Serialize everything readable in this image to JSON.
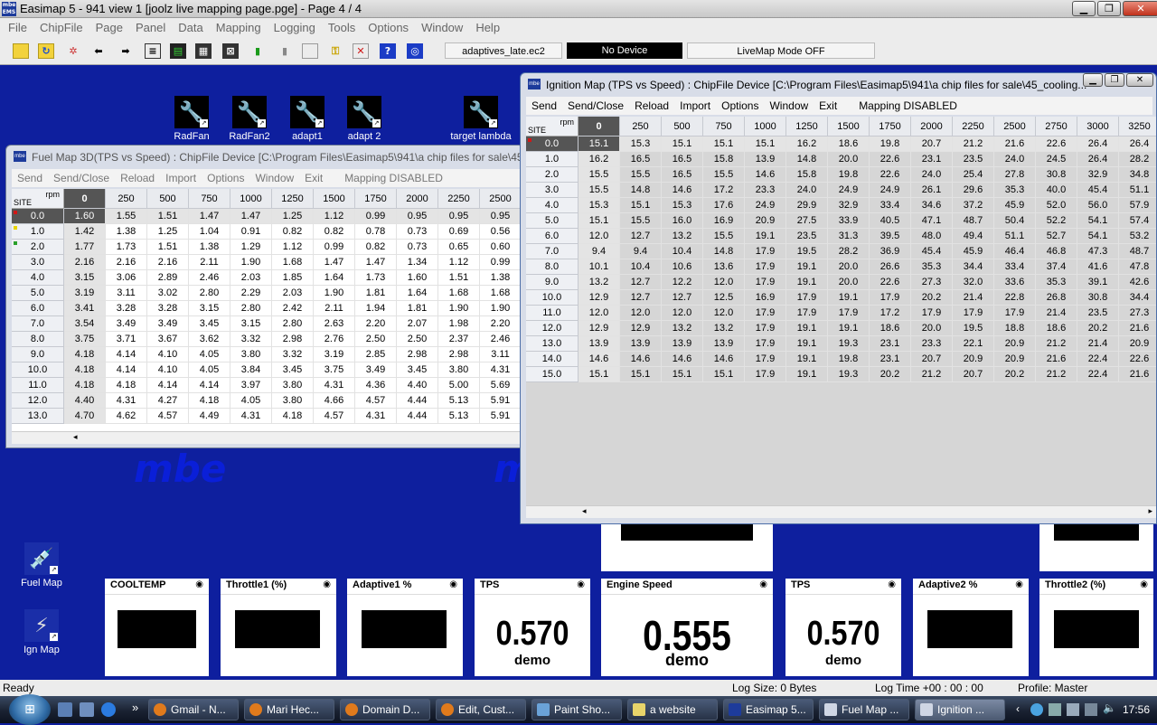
{
  "app": {
    "title": "Easimap 5 - 941 view 1 [joolz live mapping page.pge] - Page 4 / 4",
    "logo": "mbe EMS",
    "minimize": "▁",
    "restore": "❐",
    "close": "✕"
  },
  "menu": [
    "File",
    "ChipFile",
    "Page",
    "Panel",
    "Data",
    "Mapping",
    "Logging",
    "Tools",
    "Options",
    "Window",
    "Help"
  ],
  "toolbar": {
    "icons": [
      "open-icon",
      "folder-icon",
      "settings-icon",
      "back-arrow-icon",
      "forward-arrow-icon",
      "page-icon",
      "chip-icon",
      "grid-icon",
      "map-icon",
      "traffic-light-icon",
      "disk-icon",
      "blank-icon",
      "key-icon",
      "delete-icon",
      "help-icon",
      "target-icon"
    ],
    "file_field": "adaptives_late.ec2",
    "device_field": "No Device",
    "livemap_field": "LiveMap Mode OFF"
  },
  "desktop_icons": [
    {
      "label": "RadFan",
      "icon": "wrench-icon"
    },
    {
      "label": "RadFan2",
      "icon": "wrench-icon"
    },
    {
      "label": "adapt1",
      "icon": "wrench-icon"
    },
    {
      "label": "adapt 2",
      "icon": "wrench-icon"
    },
    {
      "label": "target lambda",
      "icon": "wrench-icon"
    },
    {
      "label": "Fuel Map",
      "icon": "injector-icon"
    },
    {
      "label": "Ign Map",
      "icon": "spark-plug-icon"
    }
  ],
  "watermark": "mbe",
  "fuel_map": {
    "title": "Fuel Map 3D(TPS vs Speed) : ChipFile Device [C:\\Program Files\\Easimap5\\941\\a chip files for sale\\45",
    "menu": [
      "Send",
      "Send/Close",
      "Reload",
      "Import",
      "Options",
      "Window",
      "Exit",
      "Mapping DISABLED"
    ],
    "corner_rpm": "rpm",
    "corner_site": "SITE",
    "columns": [
      "0",
      "250",
      "500",
      "750",
      "1000",
      "1250",
      "1500",
      "1750",
      "2000",
      "2250",
      "2500"
    ],
    "rows": [
      "0.0",
      "1.0",
      "2.0",
      "3.0",
      "4.0",
      "5.0",
      "6.0",
      "7.0",
      "8.0",
      "9.0",
      "10.0",
      "11.0",
      "12.0",
      "13.0"
    ],
    "cells": [
      [
        "1.60",
        "1.55",
        "1.51",
        "1.47",
        "1.47",
        "1.25",
        "1.12",
        "0.99",
        "0.95",
        "0.95",
        "0.95"
      ],
      [
        "1.42",
        "1.38",
        "1.25",
        "1.04",
        "0.91",
        "0.82",
        "0.82",
        "0.78",
        "0.73",
        "0.69",
        "0.56"
      ],
      [
        "1.77",
        "1.73",
        "1.51",
        "1.38",
        "1.29",
        "1.12",
        "0.99",
        "0.82",
        "0.73",
        "0.65",
        "0.60"
      ],
      [
        "2.16",
        "2.16",
        "2.16",
        "2.11",
        "1.90",
        "1.68",
        "1.47",
        "1.47",
        "1.34",
        "1.12",
        "0.99"
      ],
      [
        "3.15",
        "3.06",
        "2.89",
        "2.46",
        "2.03",
        "1.85",
        "1.64",
        "1.73",
        "1.60",
        "1.51",
        "1.38"
      ],
      [
        "3.19",
        "3.11",
        "3.02",
        "2.80",
        "2.29",
        "2.03",
        "1.90",
        "1.81",
        "1.64",
        "1.68",
        "1.68"
      ],
      [
        "3.41",
        "3.28",
        "3.28",
        "3.15",
        "2.80",
        "2.42",
        "2.11",
        "1.94",
        "1.81",
        "1.90",
        "1.90"
      ],
      [
        "3.54",
        "3.49",
        "3.49",
        "3.45",
        "3.15",
        "2.80",
        "2.63",
        "2.20",
        "2.07",
        "1.98",
        "2.20"
      ],
      [
        "3.75",
        "3.71",
        "3.67",
        "3.62",
        "3.32",
        "2.98",
        "2.76",
        "2.50",
        "2.50",
        "2.37",
        "2.46"
      ],
      [
        "4.18",
        "4.14",
        "4.10",
        "4.05",
        "3.80",
        "3.32",
        "3.19",
        "2.85",
        "2.98",
        "2.98",
        "3.11"
      ],
      [
        "4.18",
        "4.14",
        "4.10",
        "4.05",
        "3.84",
        "3.45",
        "3.75",
        "3.49",
        "3.45",
        "3.80",
        "4.31"
      ],
      [
        "4.18",
        "4.18",
        "4.14",
        "4.14",
        "3.97",
        "3.80",
        "4.31",
        "4.36",
        "4.40",
        "5.00",
        "5.69"
      ],
      [
        "4.40",
        "4.31",
        "4.27",
        "4.18",
        "4.05",
        "3.80",
        "4.66",
        "4.57",
        "4.44",
        "5.13",
        "5.91"
      ],
      [
        "4.70",
        "4.62",
        "4.57",
        "4.49",
        "4.31",
        "4.18",
        "4.57",
        "4.31",
        "4.44",
        "5.13",
        "5.91"
      ]
    ]
  },
  "ign_map": {
    "title": "Ignition Map (TPS vs Speed) : ChipFile Device [C:\\Program Files\\Easimap5\\941\\a chip files for sale\\45_cooling...",
    "menu": [
      "Send",
      "Send/Close",
      "Reload",
      "Import",
      "Options",
      "Window",
      "Exit",
      "Mapping DISABLED"
    ],
    "corner_rpm": "rpm",
    "corner_site": "SITE",
    "columns": [
      "0",
      "250",
      "500",
      "750",
      "1000",
      "1250",
      "1500",
      "1750",
      "2000",
      "2250",
      "2500",
      "2750",
      "3000",
      "3250"
    ],
    "rows": [
      "0.0",
      "1.0",
      "2.0",
      "3.0",
      "4.0",
      "5.0",
      "6.0",
      "7.0",
      "8.0",
      "9.0",
      "10.0",
      "11.0",
      "12.0",
      "13.0",
      "14.0",
      "15.0"
    ],
    "cells": [
      [
        "15.1",
        "15.3",
        "15.1",
        "15.1",
        "15.1",
        "16.2",
        "18.6",
        "19.8",
        "20.7",
        "21.2",
        "21.6",
        "22.6",
        "26.4",
        "26.4"
      ],
      [
        "16.2",
        "16.5",
        "16.5",
        "15.8",
        "13.9",
        "14.8",
        "20.0",
        "22.6",
        "23.1",
        "23.5",
        "24.0",
        "24.5",
        "26.4",
        "28.2"
      ],
      [
        "15.5",
        "15.5",
        "16.5",
        "15.5",
        "14.6",
        "15.8",
        "19.8",
        "22.6",
        "24.0",
        "25.4",
        "27.8",
        "30.8",
        "32.9",
        "34.8"
      ],
      [
        "15.5",
        "14.8",
        "14.6",
        "17.2",
        "23.3",
        "24.0",
        "24.9",
        "24.9",
        "26.1",
        "29.6",
        "35.3",
        "40.0",
        "45.4",
        "51.1"
      ],
      [
        "15.3",
        "15.1",
        "15.3",
        "17.6",
        "24.9",
        "29.9",
        "32.9",
        "33.4",
        "34.6",
        "37.2",
        "45.9",
        "52.0",
        "56.0",
        "57.9"
      ],
      [
        "15.1",
        "15.5",
        "16.0",
        "16.9",
        "20.9",
        "27.5",
        "33.9",
        "40.5",
        "47.1",
        "48.7",
        "50.4",
        "52.2",
        "54.1",
        "57.4"
      ],
      [
        "12.0",
        "12.7",
        "13.2",
        "15.5",
        "19.1",
        "23.5",
        "31.3",
        "39.5",
        "48.0",
        "49.4",
        "51.1",
        "52.7",
        "54.1",
        "53.2"
      ],
      [
        "9.4",
        "9.4",
        "10.4",
        "14.8",
        "17.9",
        "19.5",
        "28.2",
        "36.9",
        "45.4",
        "45.9",
        "46.4",
        "46.8",
        "47.3",
        "48.7"
      ],
      [
        "10.1",
        "10.4",
        "10.6",
        "13.6",
        "17.9",
        "19.1",
        "20.0",
        "26.6",
        "35.3",
        "34.4",
        "33.4",
        "37.4",
        "41.6",
        "47.8"
      ],
      [
        "13.2",
        "12.7",
        "12.2",
        "12.0",
        "17.9",
        "19.1",
        "20.0",
        "22.6",
        "27.3",
        "32.0",
        "33.6",
        "35.3",
        "39.1",
        "42.6"
      ],
      [
        "12.9",
        "12.7",
        "12.7",
        "12.5",
        "16.9",
        "17.9",
        "19.1",
        "17.9",
        "20.2",
        "21.4",
        "22.8",
        "26.8",
        "30.8",
        "34.4"
      ],
      [
        "12.0",
        "12.0",
        "12.0",
        "12.0",
        "17.9",
        "17.9",
        "17.9",
        "17.2",
        "17.9",
        "17.9",
        "17.9",
        "21.4",
        "23.5",
        "27.3"
      ],
      [
        "12.9",
        "12.9",
        "13.2",
        "13.2",
        "17.9",
        "19.1",
        "19.1",
        "18.6",
        "20.0",
        "19.5",
        "18.8",
        "18.6",
        "20.2",
        "21.6"
      ],
      [
        "13.9",
        "13.9",
        "13.9",
        "13.9",
        "17.9",
        "19.1",
        "19.3",
        "23.1",
        "23.3",
        "22.1",
        "20.9",
        "21.2",
        "21.4",
        "20.9"
      ],
      [
        "14.6",
        "14.6",
        "14.6",
        "14.6",
        "17.9",
        "19.1",
        "19.8",
        "23.1",
        "20.7",
        "20.9",
        "20.9",
        "21.6",
        "22.4",
        "22.6"
      ],
      [
        "15.1",
        "15.1",
        "15.1",
        "15.1",
        "17.9",
        "19.1",
        "19.3",
        "20.2",
        "21.2",
        "20.7",
        "20.2",
        "21.2",
        "22.4",
        "21.6"
      ]
    ]
  },
  "gauges": [
    {
      "title": "COOLTEMP",
      "value": "",
      "sub": ""
    },
    {
      "title": "Throttle1 (%)",
      "value": "",
      "sub": ""
    },
    {
      "title": "Adaptive1 %",
      "value": "",
      "sub": ""
    },
    {
      "title": "TPS",
      "value": "0.570",
      "sub": "demo"
    },
    {
      "title": "Engine Speed",
      "value": "0.555",
      "sub": "demo"
    },
    {
      "title": "TPS",
      "value": "0.570",
      "sub": "demo"
    },
    {
      "title": "Adaptive2 %",
      "value": "",
      "sub": ""
    },
    {
      "title": "Throttle2 (%)",
      "value": "",
      "sub": ""
    }
  ],
  "gauge_option_glyph": "◉",
  "status": {
    "ready": "Ready",
    "log_size": "Log Size: 0 Bytes",
    "log_time": "Log Time +00 : 00 : 00",
    "profile": "Profile: Master"
  },
  "taskbar": {
    "start": "⊞",
    "quicklaunch_more": "»",
    "tasks": [
      "Gmail - N...",
      "Mari Hec...",
      "Domain D...",
      "Edit, Cust...",
      "Paint Sho...",
      "a website",
      "Easimap 5...",
      "Fuel Map ...",
      "Ignition ..."
    ],
    "clock": "17:56"
  }
}
